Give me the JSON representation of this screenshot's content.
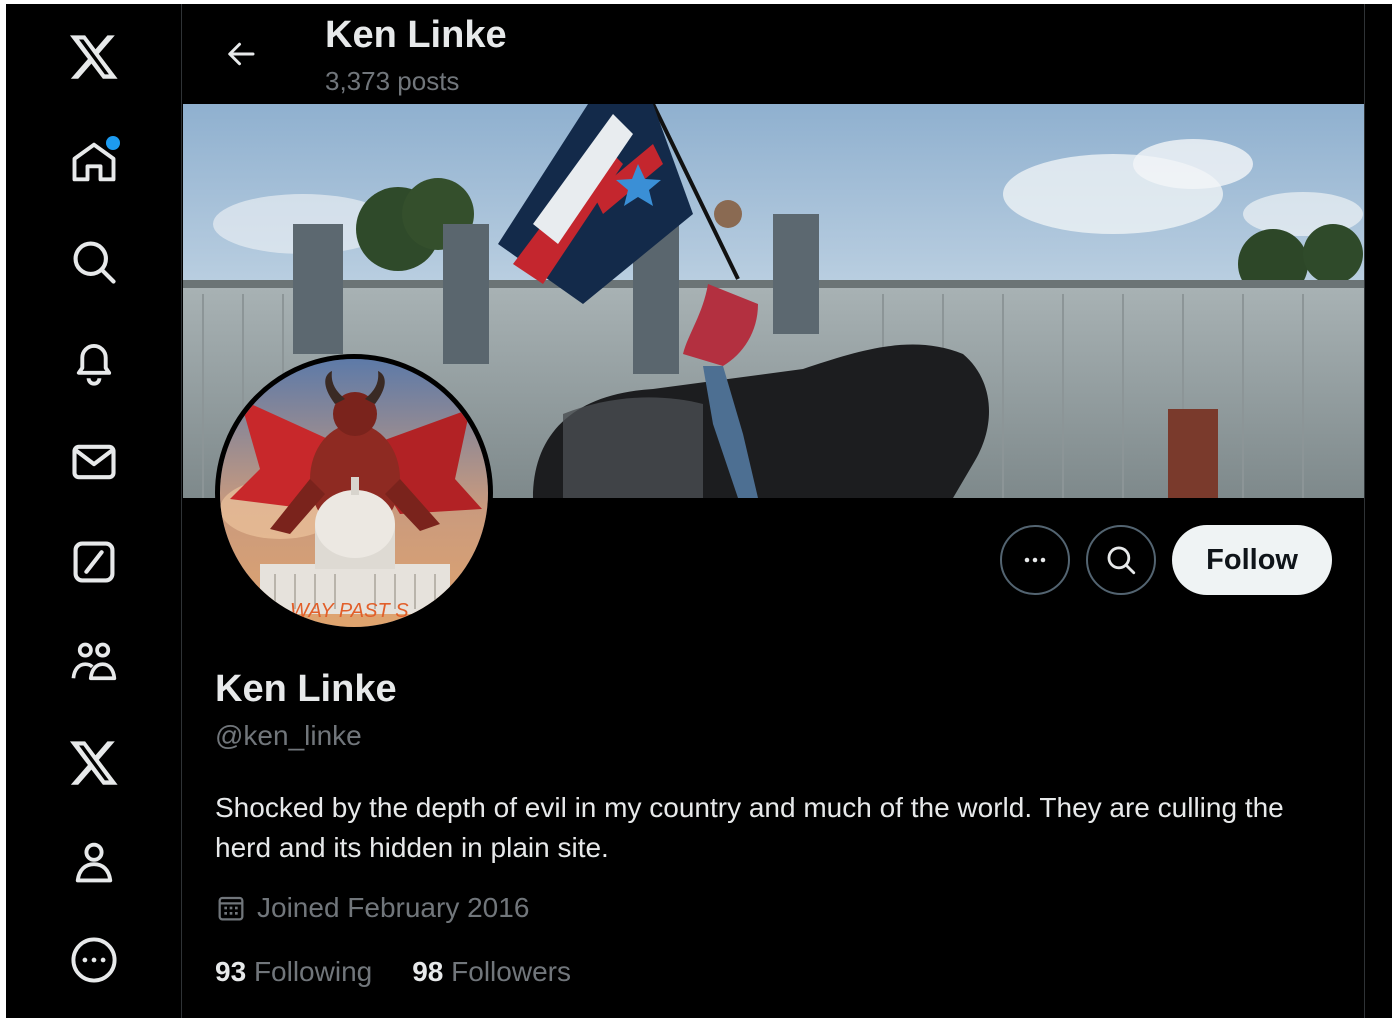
{
  "nav": {
    "logo": "x-logo-icon",
    "items": [
      {
        "name": "home",
        "icon": "home-icon",
        "has_notification": true
      },
      {
        "name": "explore",
        "icon": "search-icon"
      },
      {
        "name": "notifications",
        "icon": "bell-icon"
      },
      {
        "name": "messages",
        "icon": "envelope-icon"
      },
      {
        "name": "grok",
        "icon": "grok-icon"
      },
      {
        "name": "communities",
        "icon": "people-icon"
      },
      {
        "name": "premium",
        "icon": "x-logo-icon"
      },
      {
        "name": "profile",
        "icon": "person-icon"
      },
      {
        "name": "more",
        "icon": "more-circle-icon"
      }
    ],
    "accent": "#1d9bf0"
  },
  "header": {
    "title": "Ken Linke",
    "posts": "3,373 posts"
  },
  "profile": {
    "display_name": "Ken Linke",
    "handle": "@ken_linke",
    "bio": "Shocked by the depth of evil in my country and much of the world. They are culling the herd and its hidden in plain site.",
    "joined": "Joined February 2016",
    "following_count": "93",
    "following_label": "Following",
    "followers_count": "98",
    "followers_label": "Followers",
    "avatar_text": "WAY PAST S"
  },
  "actions": {
    "more_icon": "more-icon",
    "search_icon": "search-icon",
    "follow_label": "Follow"
  },
  "colors": {
    "background": "#000000",
    "text_primary": "#e7e9ea",
    "text_secondary": "#71767b",
    "follow_bg": "#eff3f4"
  }
}
